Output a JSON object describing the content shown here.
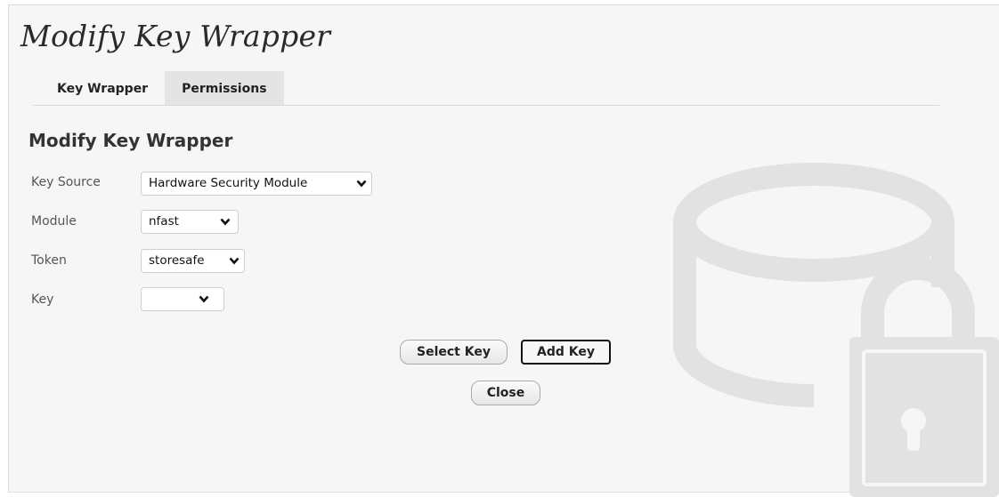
{
  "page": {
    "title": "Modify Key Wrapper"
  },
  "tabs": [
    {
      "label": "Key Wrapper",
      "active": true
    },
    {
      "label": "Permissions",
      "active": false
    }
  ],
  "form": {
    "section_title": "Modify Key Wrapper",
    "fields": [
      {
        "label": "Key Source",
        "value": "Hardware Security Module"
      },
      {
        "label": "Module",
        "value": "nfast"
      },
      {
        "label": "Token",
        "value": "storesafe"
      },
      {
        "label": "Key",
        "value": ""
      }
    ]
  },
  "buttons": {
    "select_key": "Select Key",
    "add_key": "Add Key",
    "close": "Close"
  },
  "decor": {
    "icon": "database-lock-icon",
    "color": "#e2e2e2"
  }
}
